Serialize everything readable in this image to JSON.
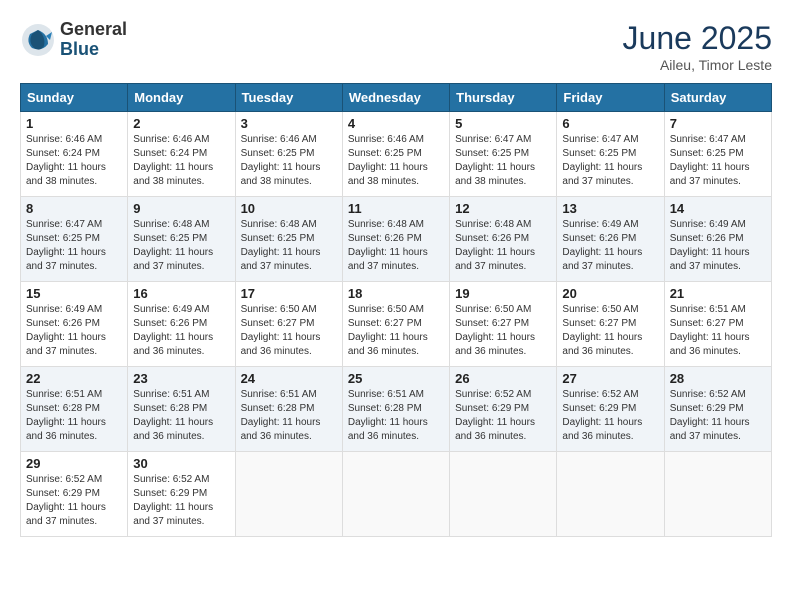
{
  "header": {
    "logo": {
      "general": "General",
      "blue": "Blue"
    },
    "title": "June 2025",
    "location": "Aileu, Timor Leste"
  },
  "weekdays": [
    "Sunday",
    "Monday",
    "Tuesday",
    "Wednesday",
    "Thursday",
    "Friday",
    "Saturday"
  ],
  "weeks": [
    [
      {
        "day": "1",
        "sunrise": "Sunrise: 6:46 AM",
        "sunset": "Sunset: 6:24 PM",
        "daylight": "Daylight: 11 hours and 38 minutes."
      },
      {
        "day": "2",
        "sunrise": "Sunrise: 6:46 AM",
        "sunset": "Sunset: 6:24 PM",
        "daylight": "Daylight: 11 hours and 38 minutes."
      },
      {
        "day": "3",
        "sunrise": "Sunrise: 6:46 AM",
        "sunset": "Sunset: 6:25 PM",
        "daylight": "Daylight: 11 hours and 38 minutes."
      },
      {
        "day": "4",
        "sunrise": "Sunrise: 6:46 AM",
        "sunset": "Sunset: 6:25 PM",
        "daylight": "Daylight: 11 hours and 38 minutes."
      },
      {
        "day": "5",
        "sunrise": "Sunrise: 6:47 AM",
        "sunset": "Sunset: 6:25 PM",
        "daylight": "Daylight: 11 hours and 38 minutes."
      },
      {
        "day": "6",
        "sunrise": "Sunrise: 6:47 AM",
        "sunset": "Sunset: 6:25 PM",
        "daylight": "Daylight: 11 hours and 37 minutes."
      },
      {
        "day": "7",
        "sunrise": "Sunrise: 6:47 AM",
        "sunset": "Sunset: 6:25 PM",
        "daylight": "Daylight: 11 hours and 37 minutes."
      }
    ],
    [
      {
        "day": "8",
        "sunrise": "Sunrise: 6:47 AM",
        "sunset": "Sunset: 6:25 PM",
        "daylight": "Daylight: 11 hours and 37 minutes."
      },
      {
        "day": "9",
        "sunrise": "Sunrise: 6:48 AM",
        "sunset": "Sunset: 6:25 PM",
        "daylight": "Daylight: 11 hours and 37 minutes."
      },
      {
        "day": "10",
        "sunrise": "Sunrise: 6:48 AM",
        "sunset": "Sunset: 6:25 PM",
        "daylight": "Daylight: 11 hours and 37 minutes."
      },
      {
        "day": "11",
        "sunrise": "Sunrise: 6:48 AM",
        "sunset": "Sunset: 6:26 PM",
        "daylight": "Daylight: 11 hours and 37 minutes."
      },
      {
        "day": "12",
        "sunrise": "Sunrise: 6:48 AM",
        "sunset": "Sunset: 6:26 PM",
        "daylight": "Daylight: 11 hours and 37 minutes."
      },
      {
        "day": "13",
        "sunrise": "Sunrise: 6:49 AM",
        "sunset": "Sunset: 6:26 PM",
        "daylight": "Daylight: 11 hours and 37 minutes."
      },
      {
        "day": "14",
        "sunrise": "Sunrise: 6:49 AM",
        "sunset": "Sunset: 6:26 PM",
        "daylight": "Daylight: 11 hours and 37 minutes."
      }
    ],
    [
      {
        "day": "15",
        "sunrise": "Sunrise: 6:49 AM",
        "sunset": "Sunset: 6:26 PM",
        "daylight": "Daylight: 11 hours and 37 minutes."
      },
      {
        "day": "16",
        "sunrise": "Sunrise: 6:49 AM",
        "sunset": "Sunset: 6:26 PM",
        "daylight": "Daylight: 11 hours and 36 minutes."
      },
      {
        "day": "17",
        "sunrise": "Sunrise: 6:50 AM",
        "sunset": "Sunset: 6:27 PM",
        "daylight": "Daylight: 11 hours and 36 minutes."
      },
      {
        "day": "18",
        "sunrise": "Sunrise: 6:50 AM",
        "sunset": "Sunset: 6:27 PM",
        "daylight": "Daylight: 11 hours and 36 minutes."
      },
      {
        "day": "19",
        "sunrise": "Sunrise: 6:50 AM",
        "sunset": "Sunset: 6:27 PM",
        "daylight": "Daylight: 11 hours and 36 minutes."
      },
      {
        "day": "20",
        "sunrise": "Sunrise: 6:50 AM",
        "sunset": "Sunset: 6:27 PM",
        "daylight": "Daylight: 11 hours and 36 minutes."
      },
      {
        "day": "21",
        "sunrise": "Sunrise: 6:51 AM",
        "sunset": "Sunset: 6:27 PM",
        "daylight": "Daylight: 11 hours and 36 minutes."
      }
    ],
    [
      {
        "day": "22",
        "sunrise": "Sunrise: 6:51 AM",
        "sunset": "Sunset: 6:28 PM",
        "daylight": "Daylight: 11 hours and 36 minutes."
      },
      {
        "day": "23",
        "sunrise": "Sunrise: 6:51 AM",
        "sunset": "Sunset: 6:28 PM",
        "daylight": "Daylight: 11 hours and 36 minutes."
      },
      {
        "day": "24",
        "sunrise": "Sunrise: 6:51 AM",
        "sunset": "Sunset: 6:28 PM",
        "daylight": "Daylight: 11 hours and 36 minutes."
      },
      {
        "day": "25",
        "sunrise": "Sunrise: 6:51 AM",
        "sunset": "Sunset: 6:28 PM",
        "daylight": "Daylight: 11 hours and 36 minutes."
      },
      {
        "day": "26",
        "sunrise": "Sunrise: 6:52 AM",
        "sunset": "Sunset: 6:29 PM",
        "daylight": "Daylight: 11 hours and 36 minutes."
      },
      {
        "day": "27",
        "sunrise": "Sunrise: 6:52 AM",
        "sunset": "Sunset: 6:29 PM",
        "daylight": "Daylight: 11 hours and 36 minutes."
      },
      {
        "day": "28",
        "sunrise": "Sunrise: 6:52 AM",
        "sunset": "Sunset: 6:29 PM",
        "daylight": "Daylight: 11 hours and 37 minutes."
      }
    ],
    [
      {
        "day": "29",
        "sunrise": "Sunrise: 6:52 AM",
        "sunset": "Sunset: 6:29 PM",
        "daylight": "Daylight: 11 hours and 37 minutes."
      },
      {
        "day": "30",
        "sunrise": "Sunrise: 6:52 AM",
        "sunset": "Sunset: 6:29 PM",
        "daylight": "Daylight: 11 hours and 37 minutes."
      },
      null,
      null,
      null,
      null,
      null
    ]
  ]
}
